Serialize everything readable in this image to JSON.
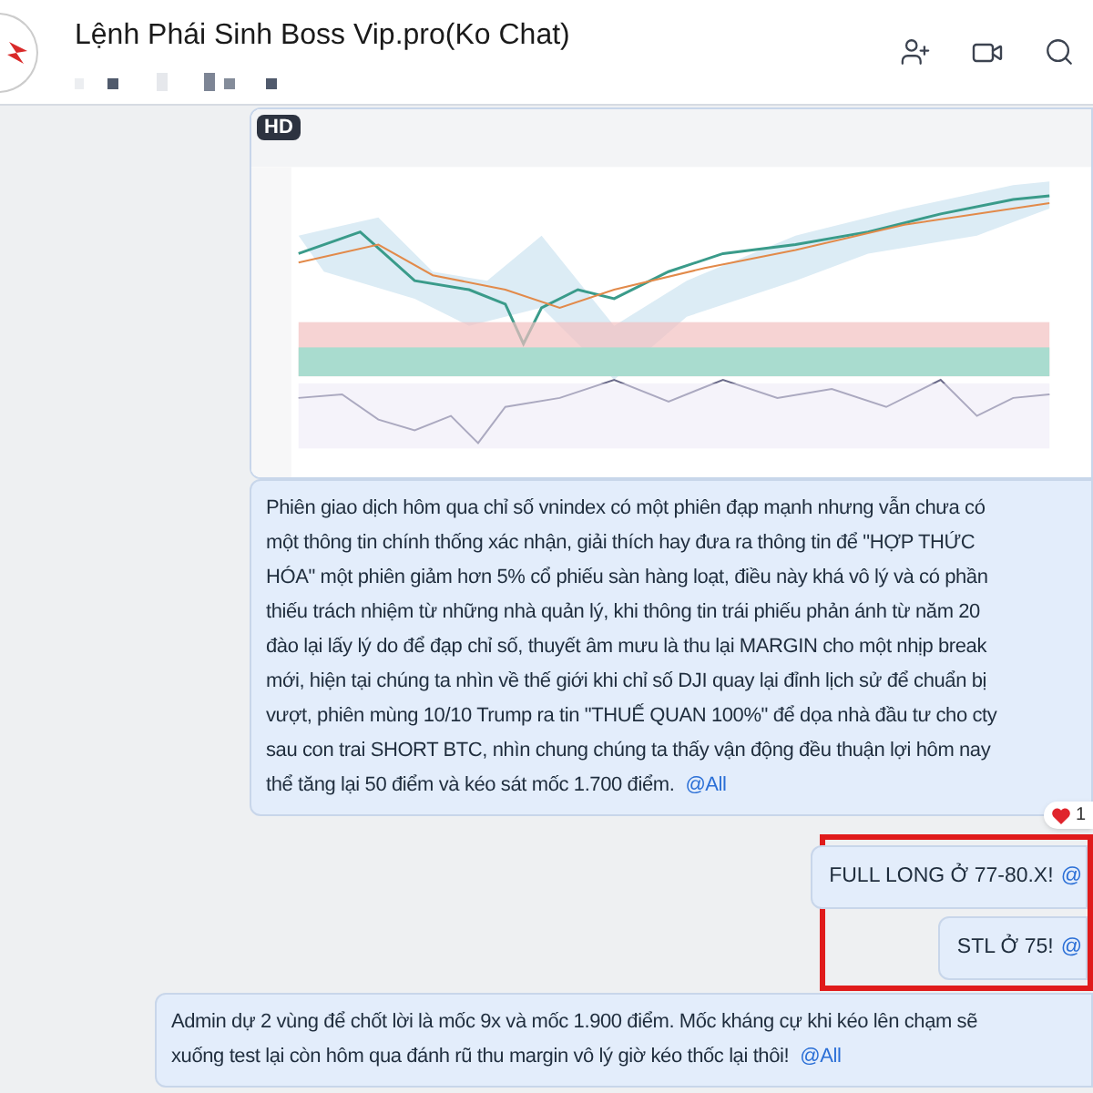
{
  "header": {
    "title": "Lệnh Phái Sinh Boss Vip.pro(Ko Chat)"
  },
  "messages": [
    {
      "badge": "HD"
    },
    {
      "kind": "text",
      "lines": [
        "Phiên giao dịch hôm qua chỉ số vnindex có một phiên đạp mạnh nhưng vẫn chưa có",
        "một thông tin chính thống xác nhận, giải thích hay đưa ra thông tin để \"HỢP THỨC",
        "HÓA\" một phiên giảm hơn 5% cổ phiếu sàn hàng loạt, điều này khá vô lý và có phần",
        "thiếu trách nhiệm từ những nhà quản lý, khi thông tin trái phiếu phản ánh từ năm 20",
        "đào lại lấy lý do để đạp chỉ số, thuyết âm mưu là thu lại MARGIN cho một nhịp break",
        "mới, hiện tại chúng ta nhìn về thế giới khi chỉ số DJI quay lại đỉnh lịch sử để chuẩn bị",
        "vượt, phiên mùng 10/10 Trump ra tin \"THUẾ QUAN 100%\" để dọa nhà đầu tư cho cty",
        "sau con trai SHORT BTC, nhìn chung chúng ta thấy vận động đều thuận lợi hôm nay",
        "thể tăng lại 50 điểm và kéo sát mốc 1.700 điểm."
      ],
      "mention": "@All",
      "reaction_count": "1"
    },
    {
      "kind": "group",
      "highlighted": true,
      "messages": [
        {
          "text": "FULL LONG Ở 77-80.X!",
          "mention": "@"
        },
        {
          "text": "STL Ở 75!",
          "mention": "@"
        }
      ]
    },
    {
      "kind": "text",
      "lines": [
        "Admin dự 2 vùng để chốt lời là mốc 9x và mốc 1.900 điểm. Mốc kháng cự khi kéo lên chạm sẽ",
        "xuống test lại còn hôm qua đánh rũ thu margin vô lý giờ kéo thốc lại thôi!"
      ],
      "mention": "@All"
    }
  ]
}
